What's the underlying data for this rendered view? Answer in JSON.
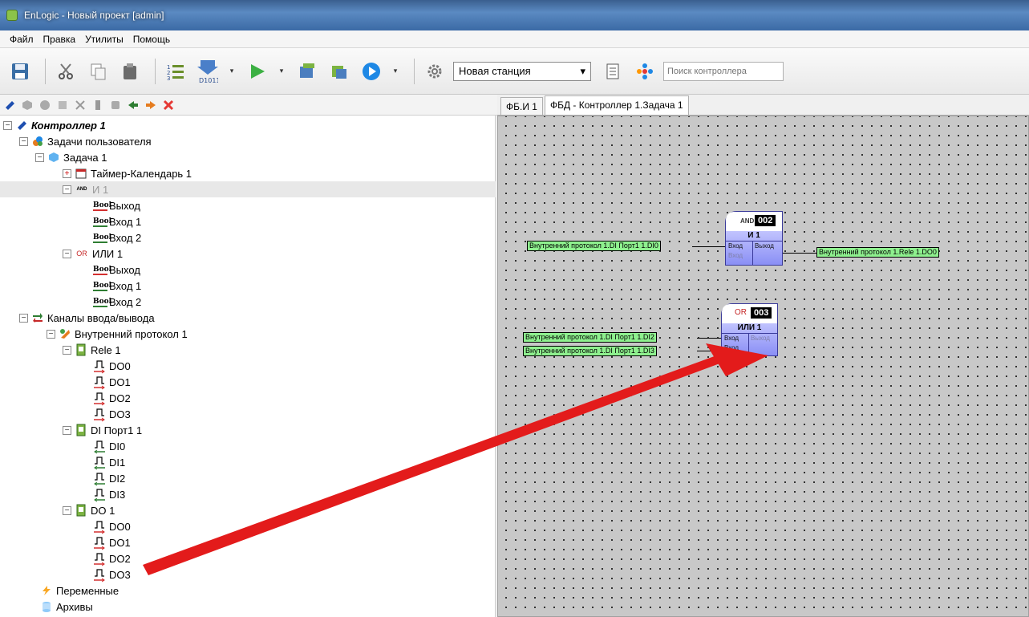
{
  "window": {
    "title": "EnLogic - Новый проект [admin]"
  },
  "menu": {
    "items": [
      "Файл",
      "Правка",
      "Утилиты",
      "Помощь"
    ]
  },
  "toolbar": {
    "station_select": "Новая станция",
    "search_placeholder": "Поиск контроллера",
    "icons": [
      "save-icon",
      "cut-icon",
      "copy-icon",
      "paste-icon",
      "list-icon",
      "download-icon",
      "run-icon",
      "db-icon",
      "sync-icon",
      "play-icon",
      "settings-icon",
      "document-icon",
      "network-icon"
    ],
    "compile_label": "D1011"
  },
  "tree": {
    "controller": "Контроллер 1",
    "user_tasks": "Задачи пользователя",
    "task": "Задача 1",
    "timer": "Таймер-Календарь 1",
    "and_block": {
      "tag": "AND",
      "name": "И 1",
      "ports": [
        "Выход",
        "Вход 1",
        "Вход 2"
      ]
    },
    "or_block": {
      "tag": "OR",
      "name": "ИЛИ 1",
      "ports": [
        "Выход",
        "Вход 1",
        "Вход 2"
      ]
    },
    "bool_label": "Bool",
    "io_channels": "Каналы ввода/вывода",
    "internal_protocol": "Внутренний протокол 1",
    "rele": {
      "name": "Rele 1",
      "items": [
        "DO0",
        "DO1",
        "DO2",
        "DO3"
      ]
    },
    "di_port": {
      "name": "DI Порт1 1",
      "items": [
        "DI0",
        "DI1",
        "DI2",
        "DI3"
      ]
    },
    "do": {
      "name": "DO 1",
      "items": [
        "DO0",
        "DO1",
        "DO2",
        "DO3"
      ]
    },
    "variables": "Переменные",
    "archives": "Архивы"
  },
  "tabs": [
    {
      "label": "ФБ.И 1",
      "active": false
    },
    {
      "label": "ФБД - Контроллер 1.Задача 1",
      "active": true
    }
  ],
  "diagram": {
    "and_block": {
      "type": "AND",
      "number": "002",
      "name": "И 1",
      "in1": "Вход",
      "in2": "Вход",
      "out": "Выход"
    },
    "or_block": {
      "type": "OR",
      "number": "003",
      "name": "ИЛИ 1",
      "in1": "Вход",
      "in2": "Вход",
      "out": "Выход"
    },
    "labels": {
      "and_in": "Внутренний протокол 1.DI Порт1 1.DI0",
      "and_out": "Внутренний протокол 1.Rele 1.DO0",
      "or_in1": "Внутренний протокол 1.DI Порт1 1.DI2",
      "or_in2": "Внутренний протокол 1.DI Порт1 1.DI3"
    }
  },
  "colors": {
    "signal_label": "#8ef08e",
    "block_fill": "#8a8ff5",
    "annotation_arrow": "#e31b1b"
  }
}
